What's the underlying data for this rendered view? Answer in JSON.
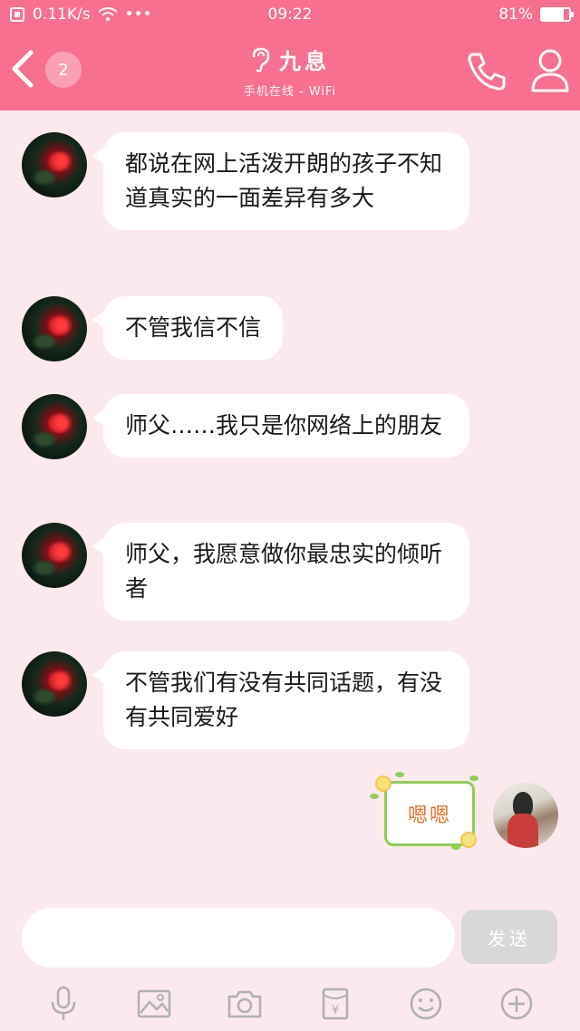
{
  "status_bar": {
    "network_speed": "0.11K/s",
    "more": "•••",
    "time": "09:22",
    "battery_percent": "81%",
    "battery_level": 0.81
  },
  "header": {
    "unread_count": "2",
    "title": "九息",
    "subtitle": "手机在线 - WiFi",
    "icons": [
      "back-chevron-icon",
      "ear-icon",
      "phone-icon",
      "person-icon"
    ]
  },
  "messages": [
    {
      "sender": "other",
      "text": "都说在网上活泼开朗的孩子不知道真实的一面差异有多大"
    },
    {
      "sender": "other",
      "text": "不管我信不信"
    },
    {
      "sender": "other",
      "text": "师父……我只是你网络上的朋友"
    },
    {
      "sender": "other",
      "text": "师父，我愿意做你最忠实的倾听者"
    },
    {
      "sender": "other",
      "text": "不管我们有没有共同话题，有没有共同爱好"
    },
    {
      "sender": "self",
      "type": "sticker",
      "text": "嗯嗯"
    }
  ],
  "input": {
    "value": "",
    "placeholder": "",
    "send_label": "发送"
  },
  "toolbar": {
    "items": [
      "microphone-icon",
      "image-icon",
      "camera-icon",
      "red-packet-icon",
      "emoji-icon",
      "plus-icon"
    ],
    "red_packet_symbol": "¥"
  },
  "colors": {
    "accent": "#f7708f",
    "background": "#fbe9ee",
    "bubble": "#ffffff",
    "send_disabled": "#d8d8d8"
  }
}
